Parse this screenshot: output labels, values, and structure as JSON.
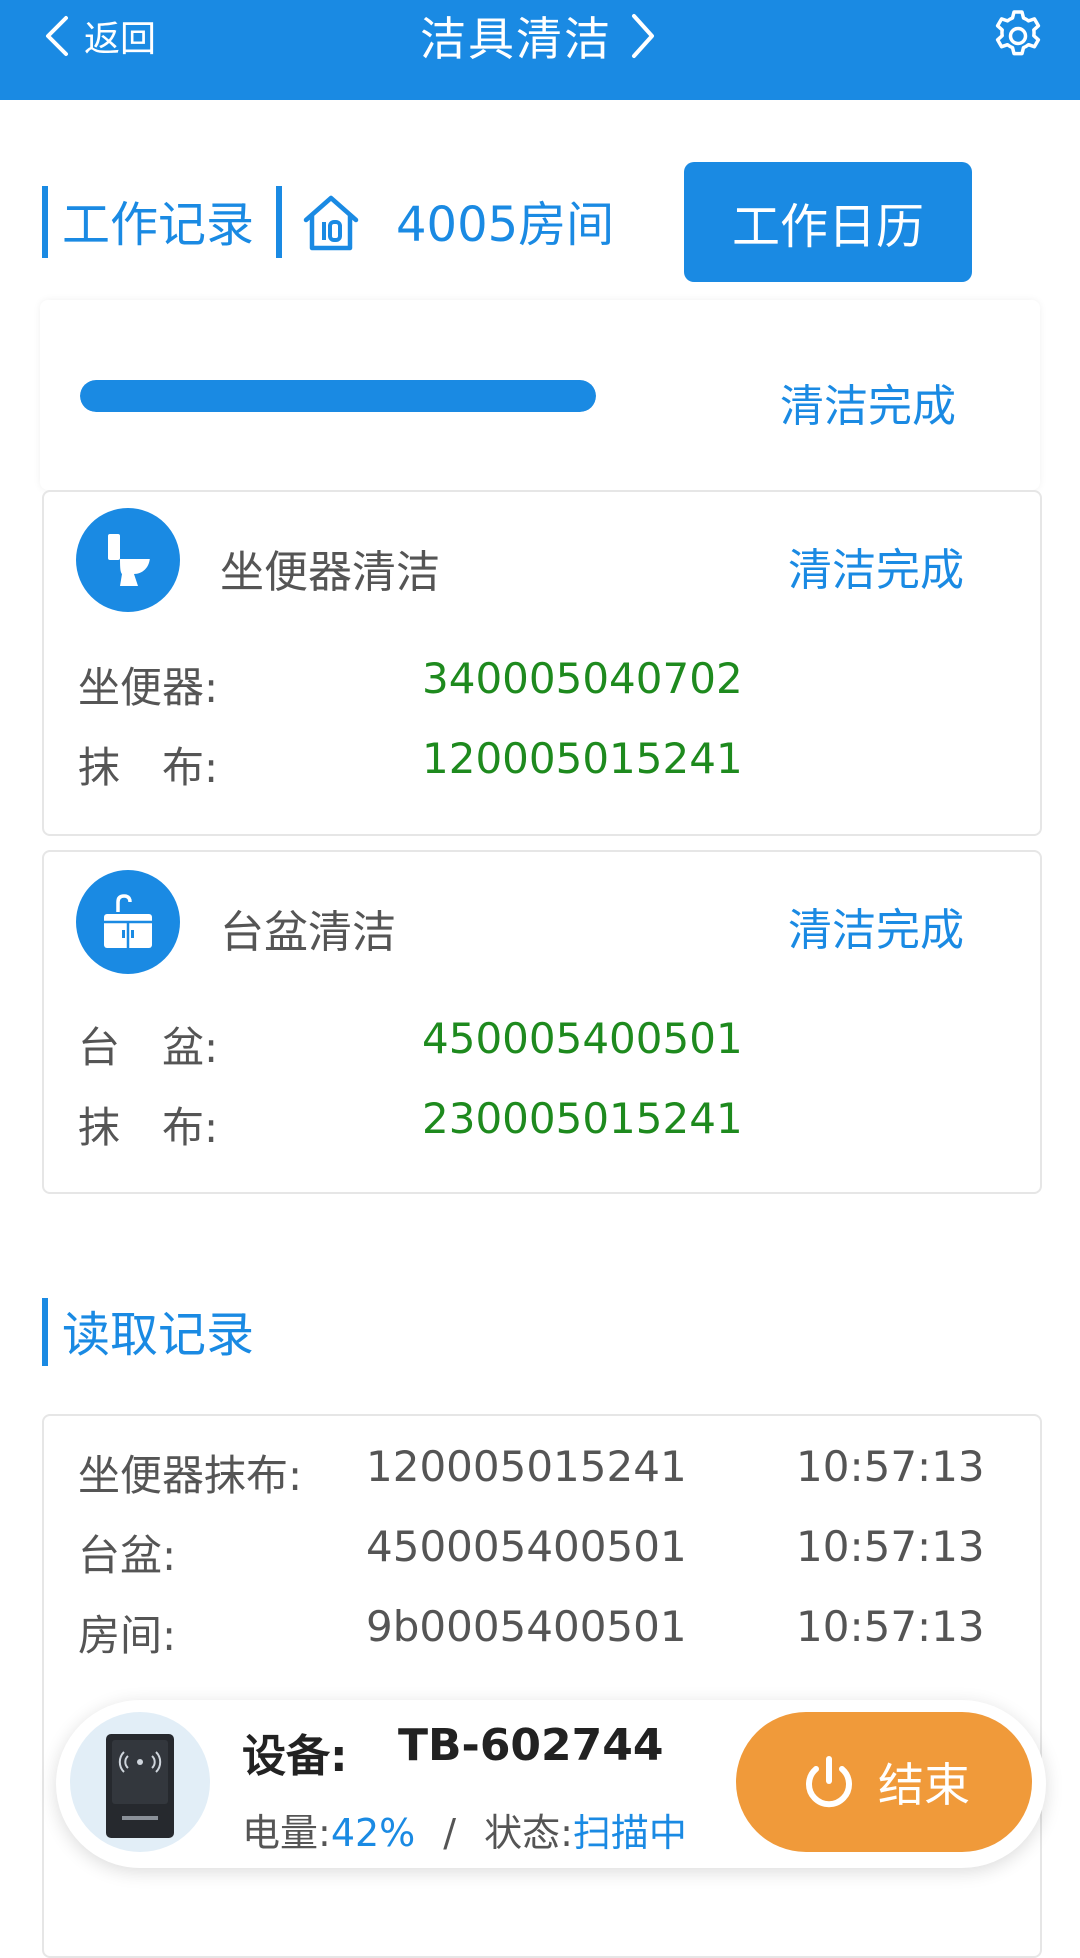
{
  "topbar": {
    "back_label": "返回",
    "title": "洁具清洁",
    "bg_color": "#1a8ae3"
  },
  "header": {
    "section_label": "工作记录",
    "room_label": "4005房间",
    "calendar_button": "工作日历"
  },
  "progress": {
    "percent": 100,
    "status": "清洁完成"
  },
  "tasks": [
    {
      "icon": "toilet-icon",
      "title": "坐便器清洁",
      "status": "清洁完成",
      "rows": [
        {
          "label": "坐便器:",
          "code": "340005040702"
        },
        {
          "label": "抹　布:",
          "code": "120005015241"
        }
      ]
    },
    {
      "icon": "sink-icon",
      "title": "台盆清洁",
      "status": "清洁完成",
      "rows": [
        {
          "label": "台　盆:",
          "code": "450005400501"
        },
        {
          "label": "抹　布:",
          "code": "230005015241"
        }
      ]
    }
  ],
  "records": {
    "title": "读取记录",
    "rows": [
      {
        "label": "坐便器抹布:",
        "code": "120005015241",
        "time": "10:57:13"
      },
      {
        "label": "台盆:",
        "code": "450005400501",
        "time": "10:57:13"
      },
      {
        "label": "房间:",
        "code": "9b0005400501",
        "time": "10:57:13"
      }
    ]
  },
  "device": {
    "label": "设备:",
    "name": "TB-602744",
    "battery_label": "电量:",
    "battery_value": "42%",
    "separator": "/",
    "status_label": "状态:",
    "status_value": "扫描中",
    "end_button": "结束",
    "end_color": "#f09a3a"
  }
}
